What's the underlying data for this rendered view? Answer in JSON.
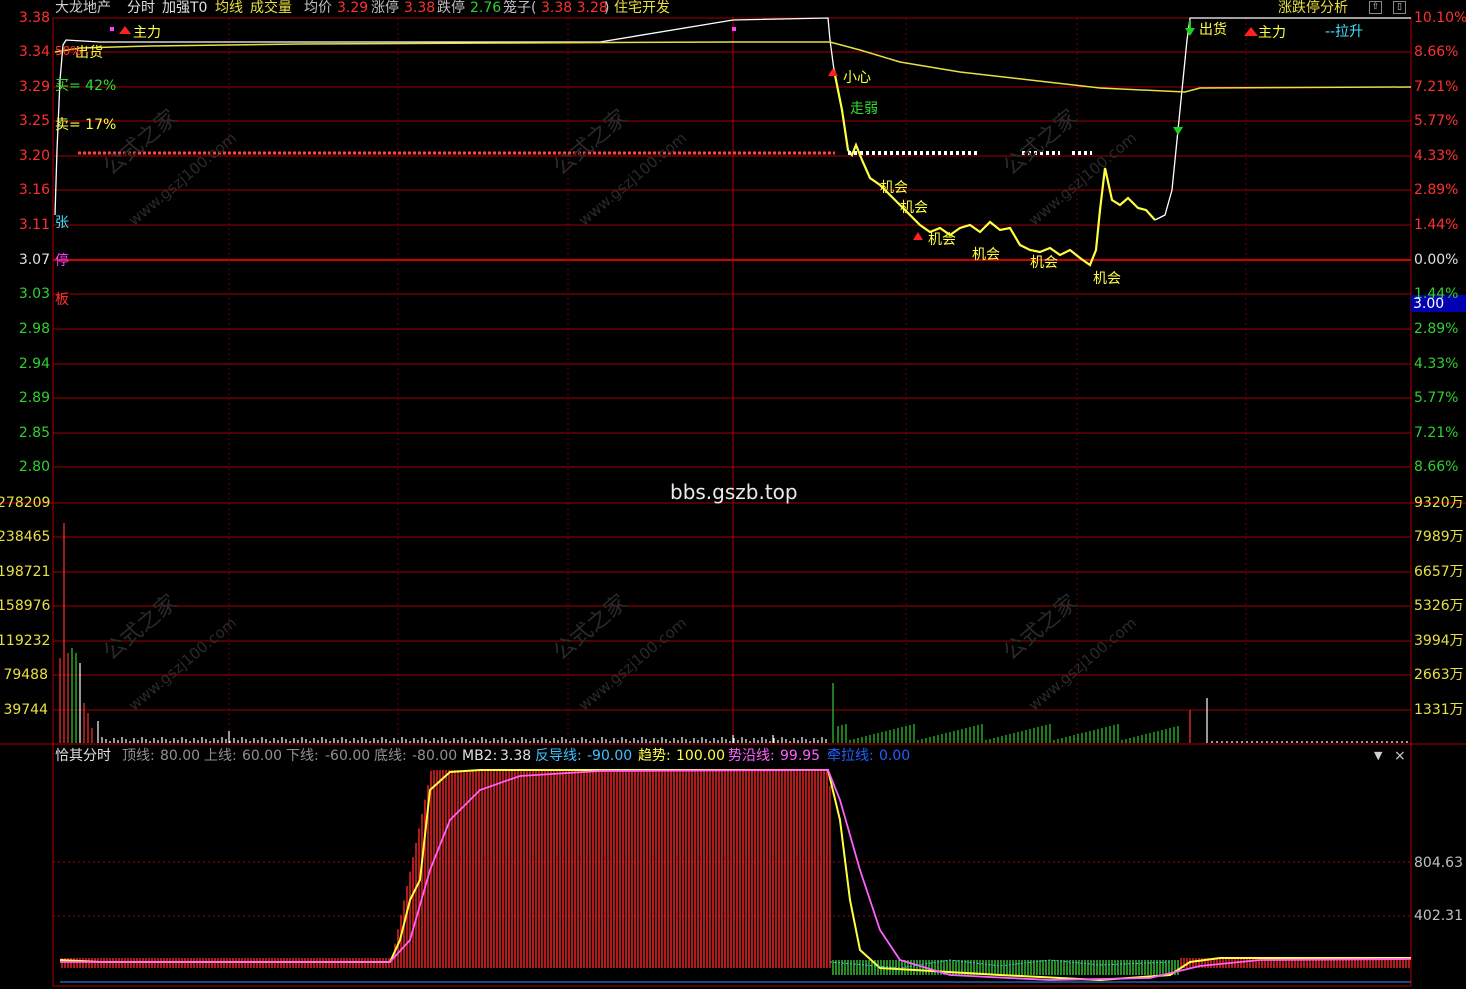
{
  "header": {
    "stock_name": "大龙地产",
    "mode": "分时",
    "enhance": "加强T0",
    "avg_line": "均线",
    "volume": "成交量",
    "avg_price_label": "均价",
    "avg_price_value": "3.29",
    "limit_up_label": "涨停",
    "limit_up_value": "3.38",
    "limit_down_label": "跌停",
    "limit_down_value": "2.76",
    "cage_label": "笼子(",
    "cage_values": "3.38 3.28",
    "cage_close": ")",
    "sector": "住宅开发",
    "right_title": "涨跌停分析"
  },
  "price_axis_left": [
    "3.38",
    "3.34",
    "3.29",
    "3.25",
    "3.20",
    "3.16",
    "3.11",
    "3.07",
    "3.03",
    "2.98",
    "2.94",
    "2.89",
    "2.85",
    "2.80"
  ],
  "price_axis_right": [
    "10.10%",
    "8.66%",
    "7.21%",
    "5.77%",
    "4.33%",
    "2.89%",
    "1.44%",
    "0.00%",
    "1.44%",
    "2.89%",
    "4.33%",
    "5.77%",
    "7.21%",
    "8.66%"
  ],
  "price_highlight": "3.00",
  "volume_axis_left": [
    "278209",
    "238465",
    "198721",
    "158976",
    "119232",
    "79488",
    "39744"
  ],
  "volume_axis_right": [
    "9320万",
    "7989万",
    "6657万",
    "5326万",
    "3994万",
    "2663万",
    "1331万"
  ],
  "annotations": {
    "zhuli_left": "主力",
    "chuhuo_left": "出货",
    "chuhuo_pct": "50%",
    "buy": "买= 42%",
    "sell": "卖= 17%",
    "zhang": "张",
    "ting": "停",
    "ban": "板",
    "xiaoxin": "小心",
    "zouruo": "走弱",
    "jihui": "机会",
    "chuhuo_right": "出货",
    "zhuli_right": "主力",
    "lasheng": "--拉升"
  },
  "watermark_site": "bbs.gszb.top",
  "watermark_text": "公式之家",
  "watermark_url": "www.gszj100.com",
  "indicator": {
    "name": "恰其分时",
    "top_line_label": "顶线:",
    "top_line": "80.00",
    "upper_label": "上线:",
    "upper": "60.00",
    "lower_label": "下线:",
    "lower": "-60.00",
    "bottom_label": "底线:",
    "bottom": "-80.00",
    "mb2_label": "MB2:",
    "mb2": "3.38",
    "guide_label": "反导线:",
    "guide": "-90.00",
    "trend_label": "趋势:",
    "trend": "100.00",
    "edge_label": "势沿线:",
    "edge": "99.95",
    "pull_label": "牵拉线:",
    "pull": "0.00",
    "axis": [
      "804.63",
      "402.31"
    ]
  },
  "colors": {
    "price_up": "#ff3030",
    "price_down": "#30d030",
    "price_line": "#ffffff",
    "avg_line": "#e8e040",
    "grid": "#b00000",
    "yellow": "#ffff40",
    "cyan": "#40e0ff",
    "magenta": "#ff40ff"
  }
}
